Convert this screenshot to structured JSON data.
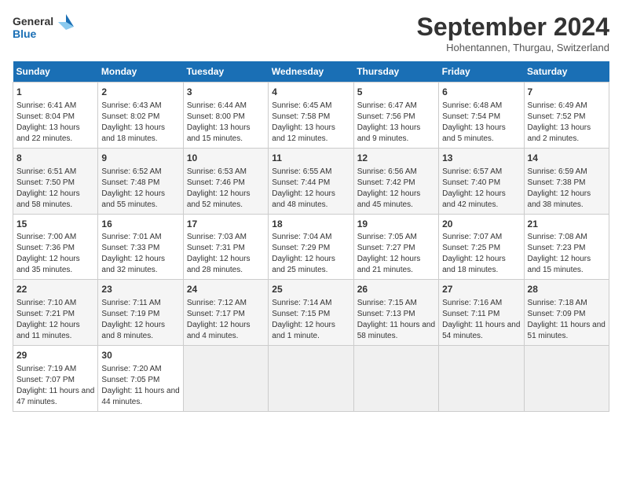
{
  "logo": {
    "line1": "General",
    "line2": "Blue"
  },
  "title": "September 2024",
  "location": "Hohentannen, Thurgau, Switzerland",
  "weekdays": [
    "Sunday",
    "Monday",
    "Tuesday",
    "Wednesday",
    "Thursday",
    "Friday",
    "Saturday"
  ],
  "weeks": [
    [
      {
        "day": "1",
        "sunrise": "Sunrise: 6:41 AM",
        "sunset": "Sunset: 8:04 PM",
        "daylight": "Daylight: 13 hours and 22 minutes."
      },
      {
        "day": "2",
        "sunrise": "Sunrise: 6:43 AM",
        "sunset": "Sunset: 8:02 PM",
        "daylight": "Daylight: 13 hours and 18 minutes."
      },
      {
        "day": "3",
        "sunrise": "Sunrise: 6:44 AM",
        "sunset": "Sunset: 8:00 PM",
        "daylight": "Daylight: 13 hours and 15 minutes."
      },
      {
        "day": "4",
        "sunrise": "Sunrise: 6:45 AM",
        "sunset": "Sunset: 7:58 PM",
        "daylight": "Daylight: 13 hours and 12 minutes."
      },
      {
        "day": "5",
        "sunrise": "Sunrise: 6:47 AM",
        "sunset": "Sunset: 7:56 PM",
        "daylight": "Daylight: 13 hours and 9 minutes."
      },
      {
        "day": "6",
        "sunrise": "Sunrise: 6:48 AM",
        "sunset": "Sunset: 7:54 PM",
        "daylight": "Daylight: 13 hours and 5 minutes."
      },
      {
        "day": "7",
        "sunrise": "Sunrise: 6:49 AM",
        "sunset": "Sunset: 7:52 PM",
        "daylight": "Daylight: 13 hours and 2 minutes."
      }
    ],
    [
      {
        "day": "8",
        "sunrise": "Sunrise: 6:51 AM",
        "sunset": "Sunset: 7:50 PM",
        "daylight": "Daylight: 12 hours and 58 minutes."
      },
      {
        "day": "9",
        "sunrise": "Sunrise: 6:52 AM",
        "sunset": "Sunset: 7:48 PM",
        "daylight": "Daylight: 12 hours and 55 minutes."
      },
      {
        "day": "10",
        "sunrise": "Sunrise: 6:53 AM",
        "sunset": "Sunset: 7:46 PM",
        "daylight": "Daylight: 12 hours and 52 minutes."
      },
      {
        "day": "11",
        "sunrise": "Sunrise: 6:55 AM",
        "sunset": "Sunset: 7:44 PM",
        "daylight": "Daylight: 12 hours and 48 minutes."
      },
      {
        "day": "12",
        "sunrise": "Sunrise: 6:56 AM",
        "sunset": "Sunset: 7:42 PM",
        "daylight": "Daylight: 12 hours and 45 minutes."
      },
      {
        "day": "13",
        "sunrise": "Sunrise: 6:57 AM",
        "sunset": "Sunset: 7:40 PM",
        "daylight": "Daylight: 12 hours and 42 minutes."
      },
      {
        "day": "14",
        "sunrise": "Sunrise: 6:59 AM",
        "sunset": "Sunset: 7:38 PM",
        "daylight": "Daylight: 12 hours and 38 minutes."
      }
    ],
    [
      {
        "day": "15",
        "sunrise": "Sunrise: 7:00 AM",
        "sunset": "Sunset: 7:36 PM",
        "daylight": "Daylight: 12 hours and 35 minutes."
      },
      {
        "day": "16",
        "sunrise": "Sunrise: 7:01 AM",
        "sunset": "Sunset: 7:33 PM",
        "daylight": "Daylight: 12 hours and 32 minutes."
      },
      {
        "day": "17",
        "sunrise": "Sunrise: 7:03 AM",
        "sunset": "Sunset: 7:31 PM",
        "daylight": "Daylight: 12 hours and 28 minutes."
      },
      {
        "day": "18",
        "sunrise": "Sunrise: 7:04 AM",
        "sunset": "Sunset: 7:29 PM",
        "daylight": "Daylight: 12 hours and 25 minutes."
      },
      {
        "day": "19",
        "sunrise": "Sunrise: 7:05 AM",
        "sunset": "Sunset: 7:27 PM",
        "daylight": "Daylight: 12 hours and 21 minutes."
      },
      {
        "day": "20",
        "sunrise": "Sunrise: 7:07 AM",
        "sunset": "Sunset: 7:25 PM",
        "daylight": "Daylight: 12 hours and 18 minutes."
      },
      {
        "day": "21",
        "sunrise": "Sunrise: 7:08 AM",
        "sunset": "Sunset: 7:23 PM",
        "daylight": "Daylight: 12 hours and 15 minutes."
      }
    ],
    [
      {
        "day": "22",
        "sunrise": "Sunrise: 7:10 AM",
        "sunset": "Sunset: 7:21 PM",
        "daylight": "Daylight: 12 hours and 11 minutes."
      },
      {
        "day": "23",
        "sunrise": "Sunrise: 7:11 AM",
        "sunset": "Sunset: 7:19 PM",
        "daylight": "Daylight: 12 hours and 8 minutes."
      },
      {
        "day": "24",
        "sunrise": "Sunrise: 7:12 AM",
        "sunset": "Sunset: 7:17 PM",
        "daylight": "Daylight: 12 hours and 4 minutes."
      },
      {
        "day": "25",
        "sunrise": "Sunrise: 7:14 AM",
        "sunset": "Sunset: 7:15 PM",
        "daylight": "Daylight: 12 hours and 1 minute."
      },
      {
        "day": "26",
        "sunrise": "Sunrise: 7:15 AM",
        "sunset": "Sunset: 7:13 PM",
        "daylight": "Daylight: 11 hours and 58 minutes."
      },
      {
        "day": "27",
        "sunrise": "Sunrise: 7:16 AM",
        "sunset": "Sunset: 7:11 PM",
        "daylight": "Daylight: 11 hours and 54 minutes."
      },
      {
        "day": "28",
        "sunrise": "Sunrise: 7:18 AM",
        "sunset": "Sunset: 7:09 PM",
        "daylight": "Daylight: 11 hours and 51 minutes."
      }
    ],
    [
      {
        "day": "29",
        "sunrise": "Sunrise: 7:19 AM",
        "sunset": "Sunset: 7:07 PM",
        "daylight": "Daylight: 11 hours and 47 minutes."
      },
      {
        "day": "30",
        "sunrise": "Sunrise: 7:20 AM",
        "sunset": "Sunset: 7:05 PM",
        "daylight": "Daylight: 11 hours and 44 minutes."
      },
      null,
      null,
      null,
      null,
      null
    ]
  ]
}
